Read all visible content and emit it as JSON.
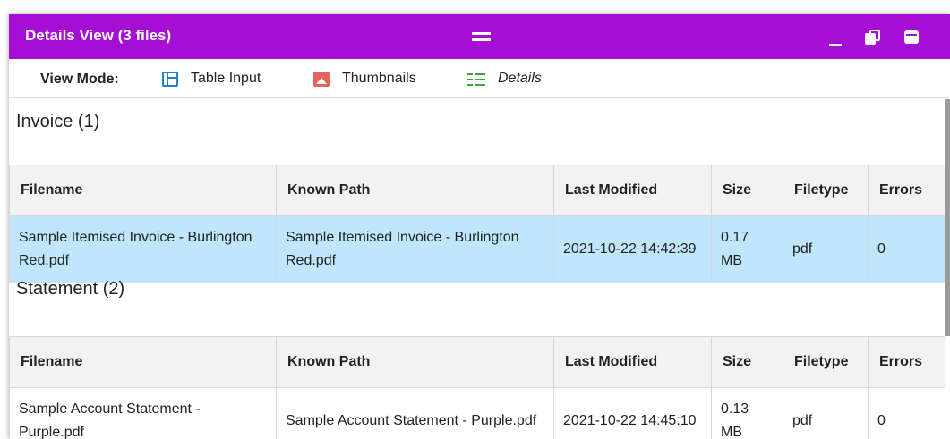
{
  "window": {
    "title": "Details View (3 files)",
    "accent_color": "#a50fd3",
    "controls": [
      "minimize-icon",
      "restore-icon",
      "maximize-icon"
    ]
  },
  "view_mode": {
    "label": "View Mode:",
    "options": [
      {
        "label": "Table Input",
        "icon": "table-icon"
      },
      {
        "label": "Thumbnails",
        "icon": "image-icon"
      },
      {
        "label": "Details",
        "icon": "checklist-icon",
        "selected": true
      }
    ]
  },
  "columns": [
    "Filename",
    "Known Path",
    "Last Modified",
    "Size",
    "Filetype",
    "Errors"
  ],
  "groups": [
    {
      "title": "Invoice (1)",
      "rows": [
        {
          "filename": "Sample Itemised Invoice - Burlington Red.pdf",
          "known_path": "Sample Itemised Invoice - Burlington Red.pdf",
          "last_modified": "2021-10-22 14:42:39",
          "size": "0.17 MB",
          "filetype": "pdf",
          "errors": "0",
          "selected": true
        }
      ]
    },
    {
      "title": "Statement (2)",
      "rows": [
        {
          "filename": "Sample Account Statement - Purple.pdf",
          "known_path": "Sample Account Statement - Purple.pdf",
          "last_modified": "2021-10-22 14:45:10",
          "size": "0.13 MB",
          "filetype": "pdf",
          "errors": "0",
          "selected": false
        }
      ]
    }
  ]
}
